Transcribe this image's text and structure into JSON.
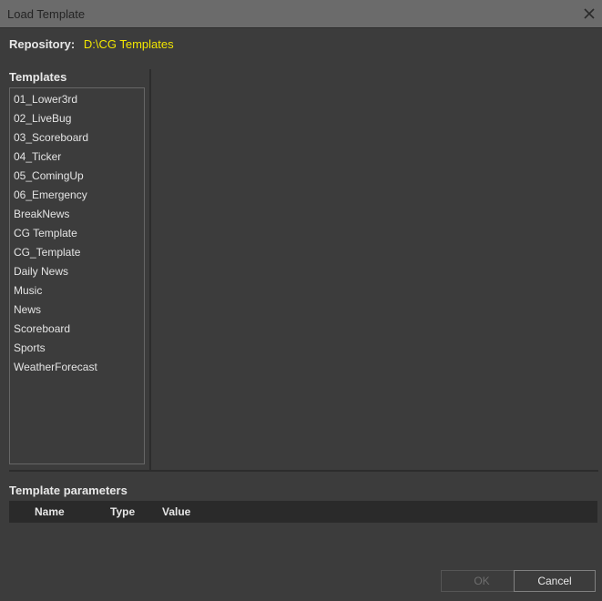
{
  "window": {
    "title": "Load Template"
  },
  "repository": {
    "label": "Repository:",
    "path": "D:\\CG Templates"
  },
  "templates": {
    "heading": "Templates",
    "items": [
      "01_Lower3rd",
      "02_LiveBug",
      "03_Scoreboard",
      "04_Ticker",
      "05_ComingUp",
      "06_Emergency",
      "BreakNews",
      "CG Template",
      "CG_Template",
      "Daily News",
      "Music",
      "News",
      "Scoreboard",
      "Sports",
      "WeatherForecast"
    ]
  },
  "parameters": {
    "heading": "Template parameters",
    "columns": {
      "name": "Name",
      "type": "Type",
      "value": "Value"
    }
  },
  "buttons": {
    "ok": "OK",
    "cancel": "Cancel"
  },
  "colors": {
    "accent_path": "#f2e600"
  },
  "icons": {
    "close": "close-icon"
  }
}
